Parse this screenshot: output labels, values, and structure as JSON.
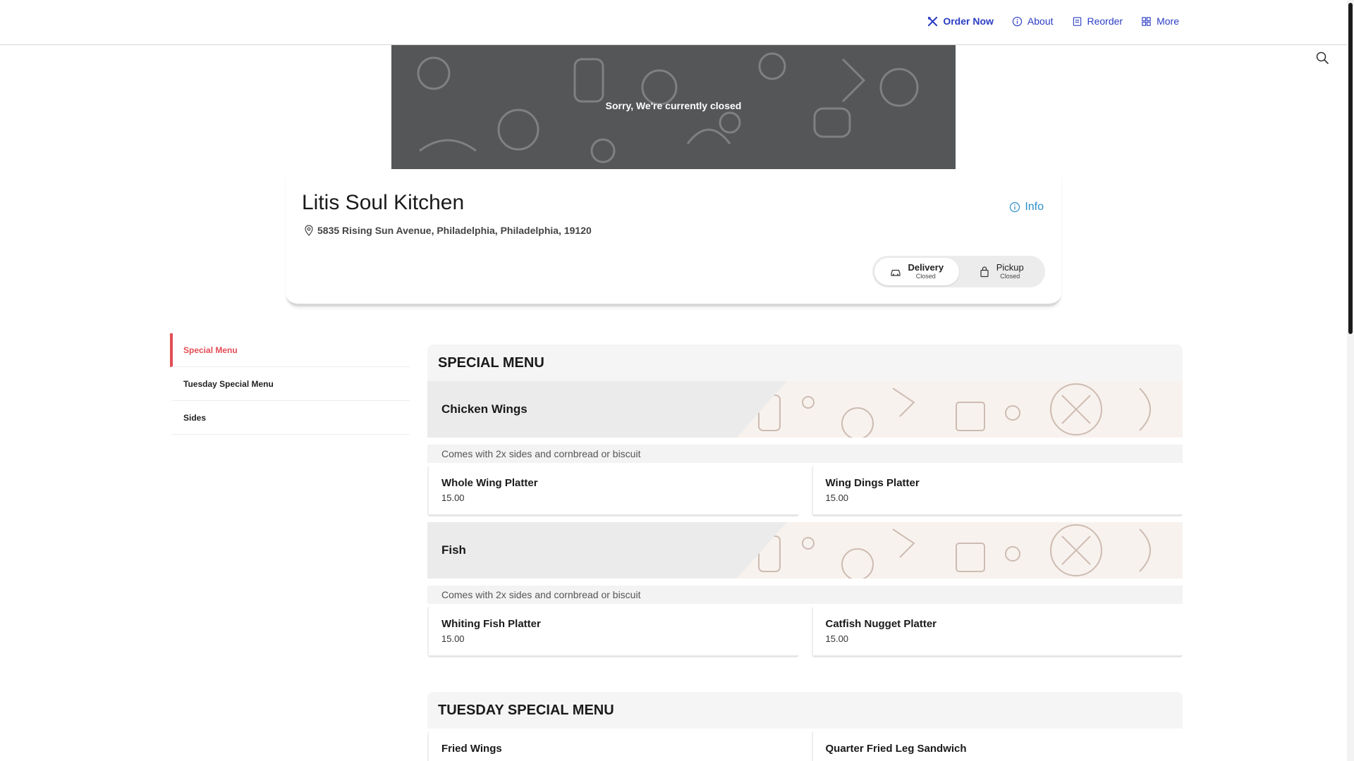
{
  "nav": {
    "items": [
      {
        "label": "Order Now",
        "icon": "utensils-icon"
      },
      {
        "label": "About",
        "icon": "info-icon"
      },
      {
        "label": "Reorder",
        "icon": "receipt-icon"
      },
      {
        "label": "More",
        "icon": "grid-icon"
      }
    ],
    "accent": "#2b3cc4"
  },
  "banner": {
    "message": "Sorry, We're currently closed"
  },
  "restaurant": {
    "name": "Litis Soul Kitchen",
    "address": "5835 Rising Sun Avenue, Philadelphia, Philadelphia, 19120",
    "info_label": "Info"
  },
  "modes": {
    "delivery": {
      "label": "Delivery",
      "status": "Closed"
    },
    "pickup": {
      "label": "Pickup",
      "status": "Closed"
    }
  },
  "sidebar": {
    "items": [
      {
        "label": "Special Menu"
      },
      {
        "label": "Tuesday Special Menu"
      },
      {
        "label": "Sides"
      }
    ],
    "active_color": "#e24d55"
  },
  "menu": {
    "special": {
      "title": "SPECIAL MENU",
      "categories": [
        {
          "title": "Chicken Wings",
          "description": "Comes with 2x sides and cornbread or biscuit",
          "items": [
            {
              "name": "Whole Wing Platter",
              "price": "15.00"
            },
            {
              "name": "Wing Dings Platter",
              "price": "15.00"
            }
          ]
        },
        {
          "title": "Fish",
          "description": "Comes with 2x sides and cornbread or biscuit",
          "items": [
            {
              "name": "Whiting Fish Platter",
              "price": "15.00"
            },
            {
              "name": "Catfish Nugget Platter",
              "price": "15.00"
            }
          ]
        }
      ]
    },
    "tuesday": {
      "title": "TUESDAY SPECIAL MENU",
      "items": [
        {
          "name": "Fried Wings"
        },
        {
          "name": "Quarter Fried Leg Sandwich"
        }
      ]
    }
  }
}
